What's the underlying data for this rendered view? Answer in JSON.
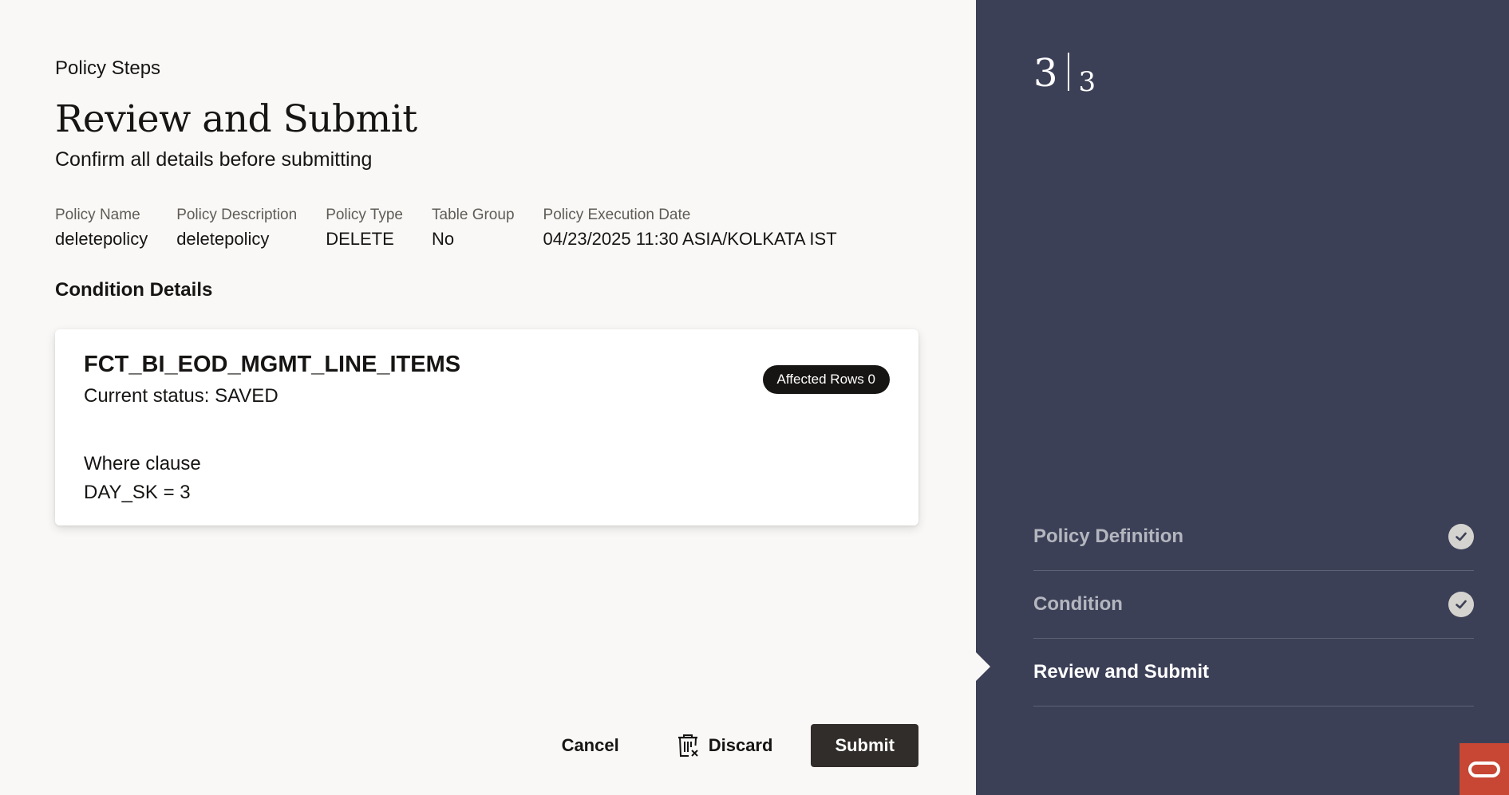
{
  "header": {
    "steps_label": "Policy Steps",
    "title": "Review and Submit",
    "subtitle": "Confirm all details before submitting"
  },
  "summary": [
    {
      "label": "Policy Name",
      "value": "deletepolicy"
    },
    {
      "label": "Policy Description",
      "value": "deletepolicy"
    },
    {
      "label": "Policy Type",
      "value": "DELETE"
    },
    {
      "label": "Table Group",
      "value": "No"
    },
    {
      "label": "Policy Execution Date",
      "value": "04/23/2025 11:30 ASIA/KOLKATA IST"
    }
  ],
  "condition": {
    "section_title": "Condition Details",
    "table_name": "FCT_BI_EOD_MGMT_LINE_ITEMS",
    "status": "Current status: SAVED",
    "badge": "Affected Rows 0",
    "where_label": "Where clause",
    "where_value": "DAY_SK = 3"
  },
  "actions": {
    "cancel": "Cancel",
    "discard": "Discard",
    "discard_icon": "trash-icon",
    "submit": "Submit"
  },
  "stepper": {
    "current": "3",
    "total": "3",
    "steps": [
      {
        "label": "Policy Definition",
        "completed": true
      },
      {
        "label": "Condition",
        "completed": true
      },
      {
        "label": "Review and Submit",
        "completed": false,
        "active": true
      }
    ]
  },
  "colors": {
    "side_panel": "#3c4057",
    "primary_button": "#312d2a",
    "oracle_red": "#c74634",
    "background": "#f9f8f6"
  }
}
